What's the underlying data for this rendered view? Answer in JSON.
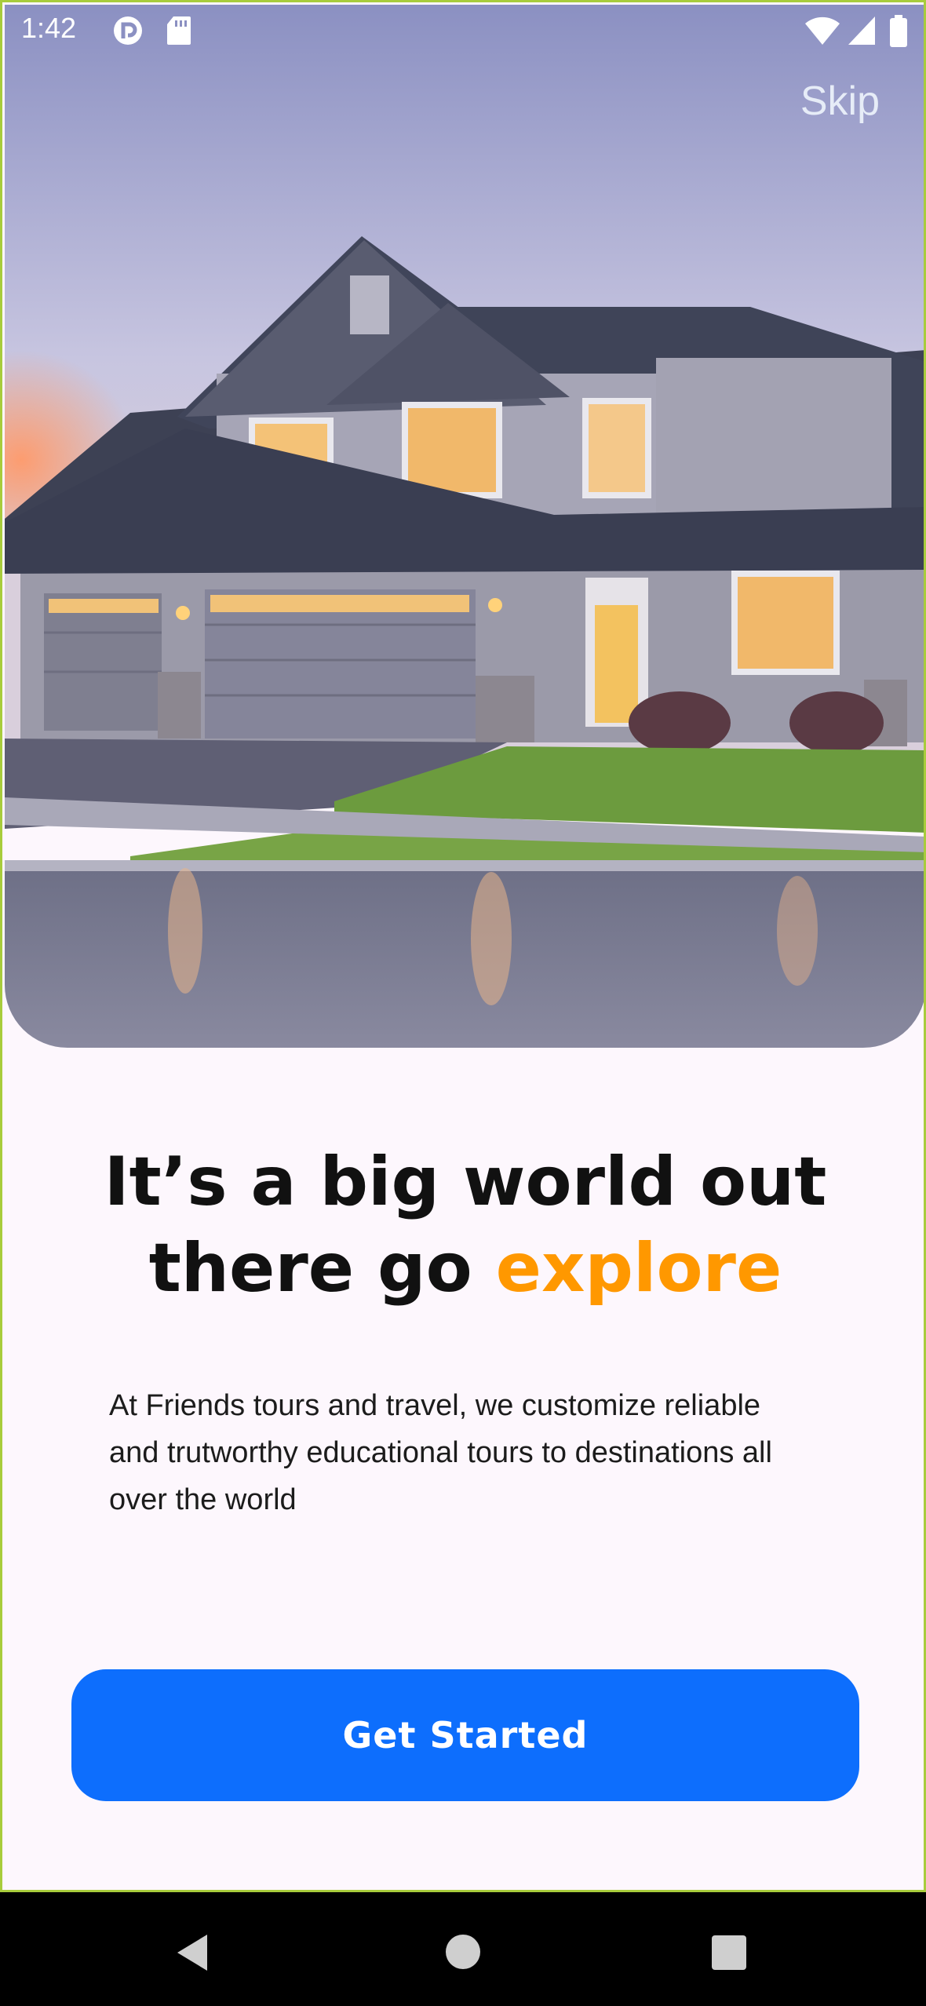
{
  "status_bar": {
    "time": "1:42",
    "icons": [
      "pocket-casts-icon",
      "sd-card-icon",
      "wifi-icon",
      "signal-icon",
      "battery-icon"
    ]
  },
  "hero": {
    "image": "house-photo",
    "skip_label": "Skip"
  },
  "headline": {
    "part1": "It’s a big world out",
    "part2": "there go ",
    "accent": "explore"
  },
  "description": "At Friends tours and travel, we customize reliable and trutworthy educational tours to destinations all over the world",
  "cta": {
    "label": "Get Started"
  },
  "nav": {
    "buttons": [
      "back-icon",
      "home-icon",
      "recents-icon"
    ]
  },
  "colors": {
    "accent": "#ff9800",
    "primary": "#0d6efd",
    "background": "#fdf7fd"
  }
}
